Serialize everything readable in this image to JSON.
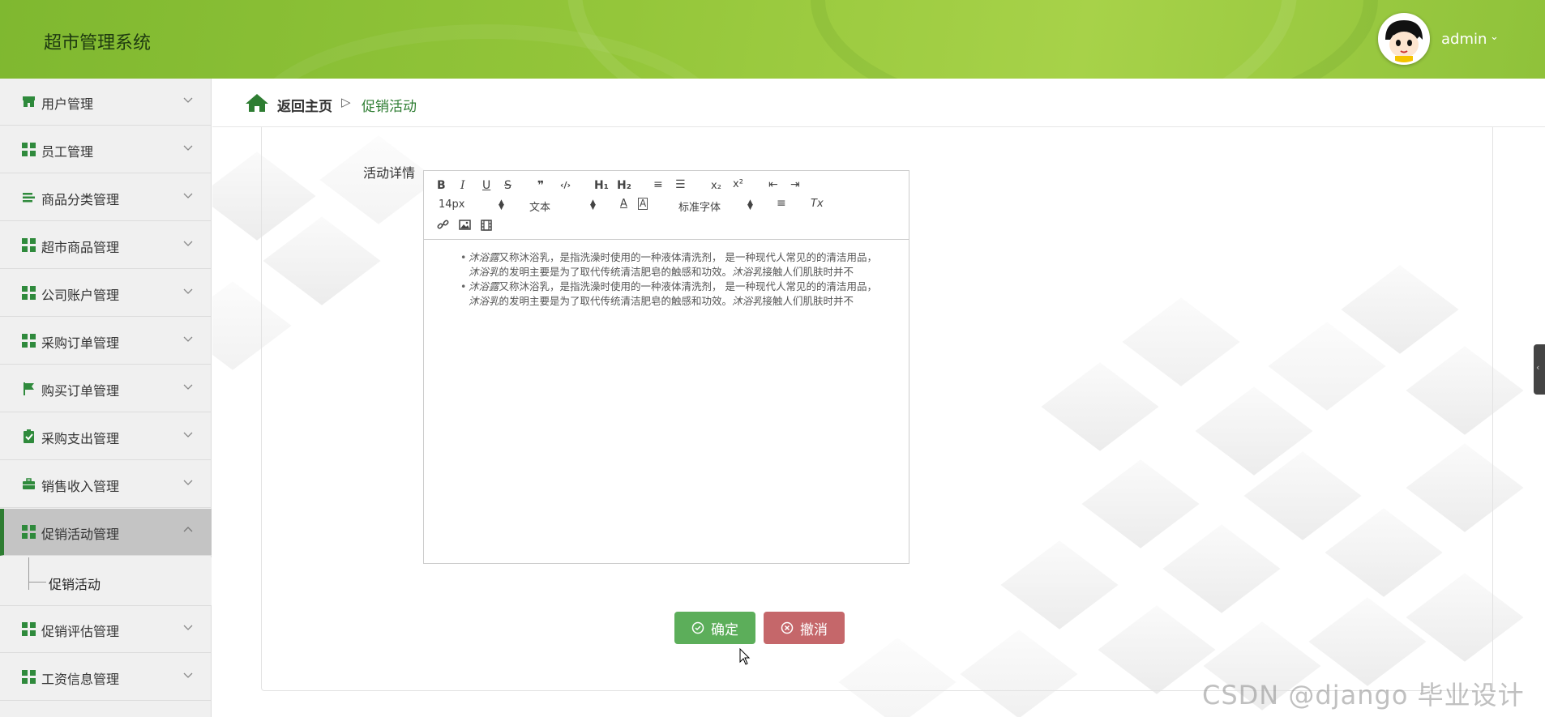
{
  "app": {
    "title": "超市管理系统",
    "user": "admin",
    "user_caret": "⌄"
  },
  "breadcrumb": {
    "home": "返回主页",
    "separator": "▷",
    "current": "促销活动"
  },
  "sidebar": {
    "items": [
      {
        "label": "用户管理",
        "icon": "store-icon"
      },
      {
        "label": "员工管理",
        "icon": "grid-icon"
      },
      {
        "label": "商品分类管理",
        "icon": "list-icon"
      },
      {
        "label": "超市商品管理",
        "icon": "grid-icon"
      },
      {
        "label": "公司账户管理",
        "icon": "grid-icon"
      },
      {
        "label": "采购订单管理",
        "icon": "grid-icon"
      },
      {
        "label": "购买订单管理",
        "icon": "flag-icon"
      },
      {
        "label": "采购支出管理",
        "icon": "clipboard-check-icon"
      },
      {
        "label": "销售收入管理",
        "icon": "briefcase-icon"
      },
      {
        "label": "促销活动管理",
        "icon": "grid-icon",
        "expanded": true
      },
      {
        "label": "促销评估管理",
        "icon": "grid-icon"
      },
      {
        "label": "工资信息管理",
        "icon": "grid-icon"
      }
    ],
    "submenu": {
      "label": "促销活动"
    }
  },
  "form": {
    "detail_label": "活动详情",
    "toolbar": {
      "bold": "B",
      "italic": "I",
      "underline": "U",
      "strike": "S",
      "quote": "❞",
      "code": "‹/›",
      "h1": "H₁",
      "h2": "H₂",
      "ordered_list": "≡",
      "bullet_list": "☰",
      "subscript": "x₂",
      "superscript": "x²",
      "outdent": "⇤",
      "indent": "⇥",
      "font_size": "14px",
      "header": "文本",
      "font_family": "标准字体",
      "color": "A",
      "background": "A",
      "align": "≡",
      "clean": "Tx",
      "link": "link",
      "image": "image",
      "video": "video"
    },
    "content": [
      {
        "line1_em": "沐浴露",
        "line1": "又称沐浴乳，是指洗澡时使用的一种液体清洗剂， 是一种现代人常见的的清洁用品，",
        "line2_em": "沐浴乳",
        "line2": "的发明主要是为了取代传统清洁肥皂的触感和功效。",
        "line2_tail_em": "沐浴乳",
        "line2_tail": "接触人们肌肤时并不"
      },
      {
        "line1_em": "沐浴露",
        "line1": "又称沐浴乳，是指洗澡时使用的一种液体清洗剂， 是一种现代人常见的的清洁用品，",
        "line2_em": "沐浴乳",
        "line2": "的发明主要是为了取代传统清洁肥皂的触感和功效。",
        "line2_tail_em": "沐浴乳",
        "line2_tail": "接触人们肌肤时并不"
      }
    ],
    "ok_button": "确定",
    "cancel_button": "撤消"
  },
  "watermark": "CSDN @django 毕业设计",
  "colors": {
    "brand_green": "#8dc13a",
    "accent_dark_green": "#2e7d32",
    "ok": "#5cae5a",
    "cancel": "#c5676a"
  }
}
